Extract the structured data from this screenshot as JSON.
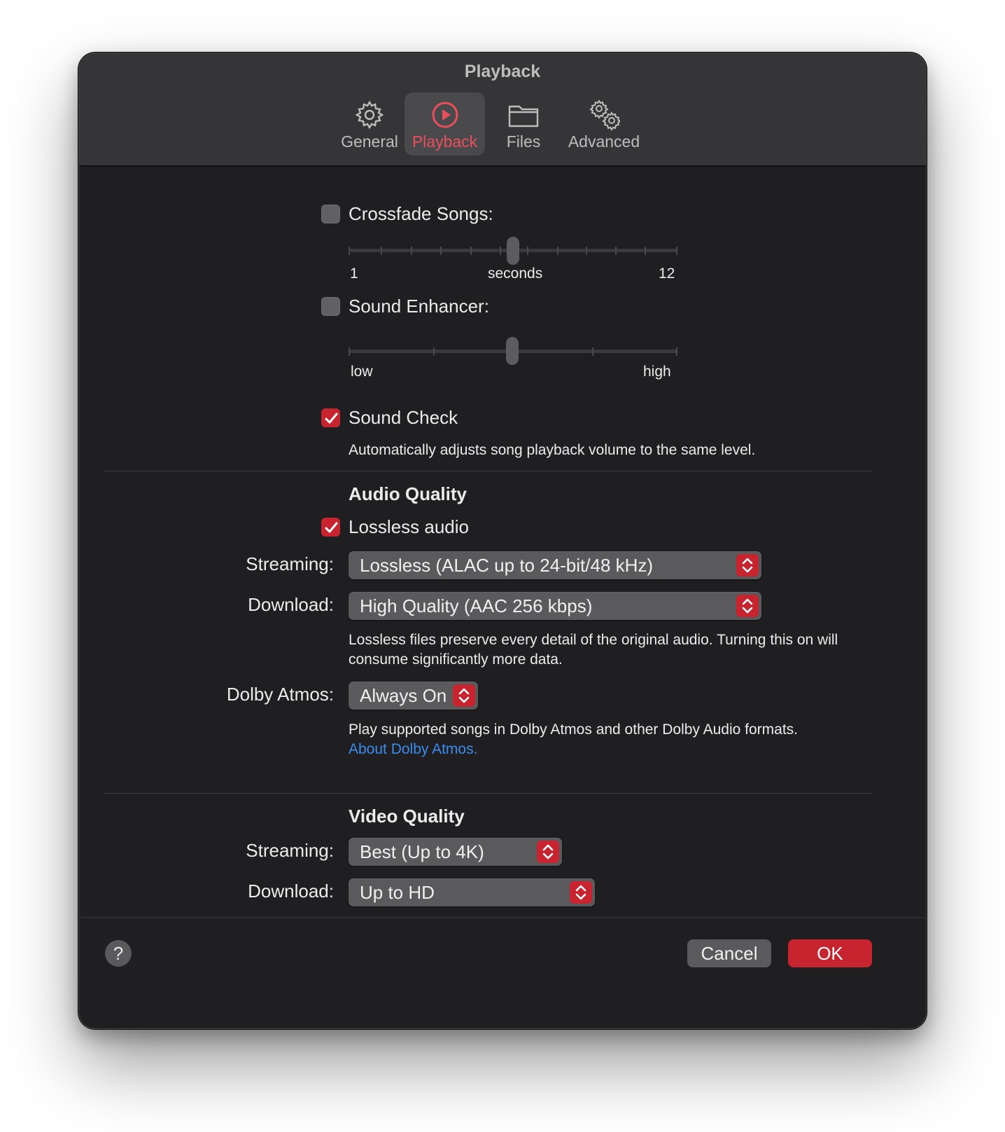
{
  "window": {
    "title": "Playback"
  },
  "tabs": [
    {
      "label": "General",
      "icon": "gear-icon"
    },
    {
      "label": "Playback",
      "icon": "play-circle-icon",
      "active": true
    },
    {
      "label": "Files",
      "icon": "folder-icon"
    },
    {
      "label": "Advanced",
      "icon": "gears-icon"
    }
  ],
  "crossfade": {
    "label": "Crossfade Songs:",
    "checked": false,
    "min_label": "1",
    "unit_label": "seconds",
    "max_label": "12",
    "value": 6
  },
  "sound_enhancer": {
    "label": "Sound Enhancer:",
    "checked": false,
    "low_label": "low",
    "high_label": "high",
    "level": 0.5
  },
  "sound_check": {
    "label": "Sound Check",
    "checked": true,
    "description": "Automatically adjusts song playback volume to the same level."
  },
  "audio_quality": {
    "header": "Audio Quality",
    "lossless_label": "Lossless audio",
    "lossless_checked": true,
    "streaming_label": "Streaming:",
    "streaming_value": "Lossless (ALAC up to 24-bit/48 kHz)",
    "download_label": "Download:",
    "download_value": "High Quality (AAC 256 kbps)",
    "lossless_note": "Lossless files preserve every detail of the original audio. Turning this on will consume significantly more data.",
    "dolby_label": "Dolby Atmos:",
    "dolby_value": "Always On",
    "dolby_note": "Play supported songs in Dolby Atmos and other Dolby Audio formats.",
    "dolby_link": "About Dolby Atmos."
  },
  "video_quality": {
    "header": "Video Quality",
    "streaming_label": "Streaming:",
    "streaming_value": "Best (Up to 4K)",
    "download_label": "Download:",
    "download_value": "Up to HD"
  },
  "footer": {
    "help_label": "?",
    "cancel_label": "Cancel",
    "ok_label": "OK"
  },
  "colors": {
    "accent": "#c8242f",
    "active_tab_text": "#ea4f5c",
    "link": "#3c8cf0",
    "window_bg": "#1f1f21",
    "titlebar_bg": "#353537"
  }
}
